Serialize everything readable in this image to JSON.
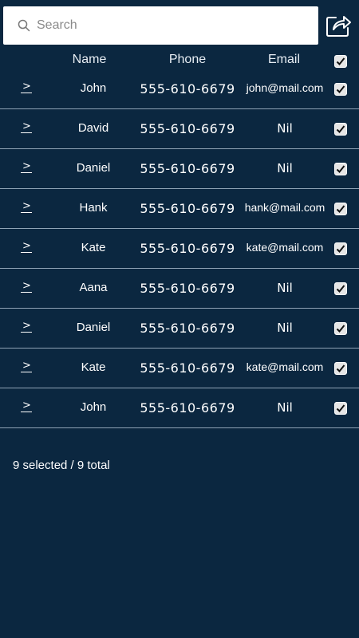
{
  "search": {
    "placeholder": "Search",
    "value": ""
  },
  "header": {
    "name": "Name",
    "phone": "Phone",
    "email": "Email",
    "select_all_checked": true
  },
  "rows": [
    {
      "name": "John",
      "phone": "555-610-6679",
      "email": "john@mail.com",
      "checked": true
    },
    {
      "name": "David",
      "phone": "555-610-6679",
      "email": "Nil",
      "checked": true
    },
    {
      "name": "Daniel",
      "phone": "555-610-6679",
      "email": "Nil",
      "checked": true
    },
    {
      "name": "Hank",
      "phone": "555-610-6679",
      "email": "hank@mail.com",
      "checked": true
    },
    {
      "name": "Kate",
      "phone": "555-610-6679",
      "email": "kate@mail.com",
      "checked": true
    },
    {
      "name": "Aana",
      "phone": "555-610-6679",
      "email": "Nil",
      "checked": true
    },
    {
      "name": "Daniel",
      "phone": "555-610-6679",
      "email": "Nil",
      "checked": true
    },
    {
      "name": "Kate",
      "phone": "555-610-6679",
      "email": "kate@mail.com",
      "checked": true
    },
    {
      "name": "John",
      "phone": "555-610-6679",
      "email": "Nil",
      "checked": true
    }
  ],
  "footer": {
    "selection_summary": "9 selected / 9 total"
  },
  "icons": {
    "search": "search-icon",
    "share": "share-icon",
    "expand": "chevron-right-icon",
    "check": "checkmark-icon"
  },
  "colors": {
    "background": "#0b2740",
    "divider": "#8fa3b5",
    "text": "#ffffff"
  }
}
